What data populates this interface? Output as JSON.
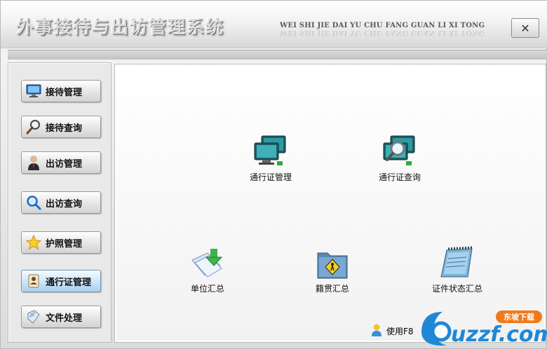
{
  "header": {
    "title_cn": "外事接待与出访管理系统",
    "title_en": "WEI SHI JIE DAI YU CHU FANG GUAN LI XI TONG",
    "close_label": "✕"
  },
  "sidebar": {
    "items": [
      {
        "label": "接待管理",
        "icon": "monitor-icon"
      },
      {
        "label": "接待查询",
        "icon": "magnifier-icon"
      },
      {
        "label": "出访管理",
        "icon": "person-icon"
      },
      {
        "label": "出访查询",
        "icon": "search-icon"
      },
      {
        "label": "护照管理",
        "icon": "star-icon"
      },
      {
        "label": "通行证管理",
        "icon": "pass-icon",
        "active": true
      },
      {
        "label": "文件处理",
        "icon": "document-icon"
      }
    ]
  },
  "main": {
    "tiles": [
      {
        "label": "通行证管理",
        "icon": "computers-icon"
      },
      {
        "label": "通行证查询",
        "icon": "computer-search-icon"
      },
      {
        "label": "单位汇总",
        "icon": "download-docs-icon"
      },
      {
        "label": "籍贯汇总",
        "icon": "road-sign-folder-icon"
      },
      {
        "label": "证件状态汇总",
        "icon": "notepad-icon"
      }
    ],
    "hint": "使用F8"
  },
  "watermark": {
    "brand": "uzzf.com",
    "tag": "东坡下载"
  },
  "colors": {
    "active_button": "#cfe7fa",
    "watermark_blue": "#1e88d6",
    "watermark_orange": "#f07a1a"
  }
}
